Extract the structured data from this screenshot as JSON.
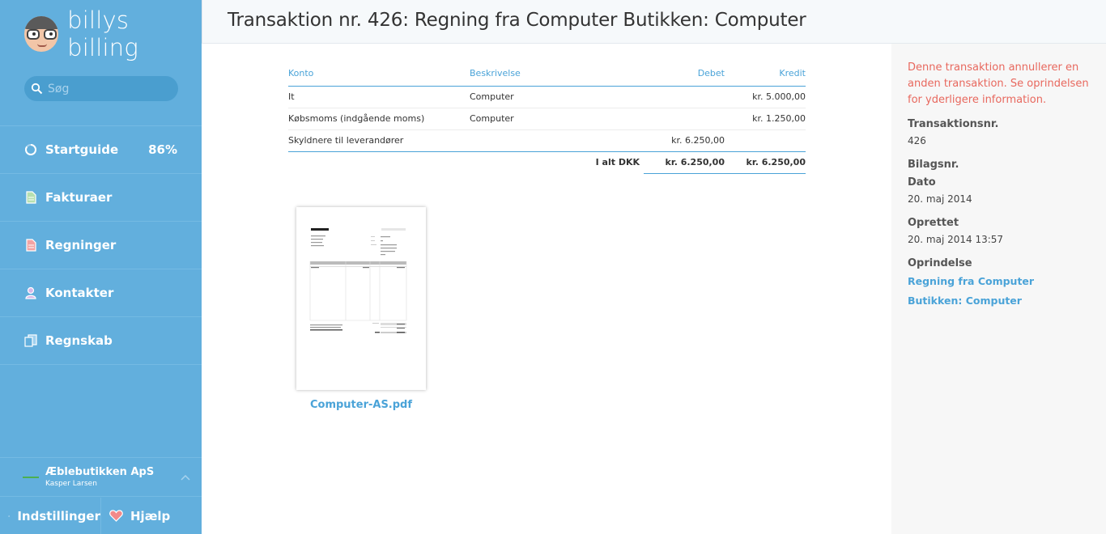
{
  "app": {
    "logo_text": "billys billing"
  },
  "search": {
    "placeholder": "Søg"
  },
  "sidebar": {
    "items": [
      {
        "label": "Startguide",
        "badge": "86%",
        "icon": "progress-circle-icon"
      },
      {
        "label": "Fakturaer",
        "icon": "invoice-document-icon"
      },
      {
        "label": "Regninger",
        "icon": "bill-document-icon"
      },
      {
        "label": "Kontakter",
        "icon": "person-icon"
      },
      {
        "label": "Regnskab",
        "icon": "accounting-docs-icon"
      }
    ],
    "company": {
      "name": "Æblebutikken ApS",
      "user": "Kasper Larsen"
    },
    "settings_label": "Indstillinger",
    "help_label": "Hjælp"
  },
  "header": {
    "title": "Transaktion nr. 426: Regning fra Computer Butikken: Computer"
  },
  "table": {
    "columns": {
      "konto": "Konto",
      "beskrivelse": "Beskrivelse",
      "debet": "Debet",
      "kredit": "Kredit"
    },
    "rows": [
      {
        "konto": "It",
        "beskrivelse": "Computer",
        "debet": "",
        "kredit": "kr. 5.000,00"
      },
      {
        "konto": "Købsmoms (indgående moms)",
        "beskrivelse": "Computer",
        "debet": "",
        "kredit": "kr. 1.250,00"
      },
      {
        "konto": "Skyldnere til leverandører",
        "beskrivelse": "",
        "debet": "kr. 6.250,00",
        "kredit": ""
      }
    ],
    "total": {
      "label": "I alt DKK",
      "debet": "kr. 6.250,00",
      "kredit": "kr. 6.250,00"
    }
  },
  "attachment": {
    "filename": "Computer-AS.pdf"
  },
  "details": {
    "warning": "Denne transaktion annullerer en anden transaktion. Se oprindelsen for yderligere information.",
    "transaction_no_label": "Transaktionsnr.",
    "transaction_no": "426",
    "voucher_label": "Bilagsnr.",
    "date_label": "Dato",
    "date": "20. maj 2014",
    "created_label": "Oprettet",
    "created": "20. maj 2014 13:57",
    "origin_label": "Oprindelse",
    "origin_link": "Regning fra Computer Butikken: Computer"
  },
  "colors": {
    "sidebar": "#62afdd",
    "accent": "#4aa3d8",
    "warning": "#e8685e"
  }
}
